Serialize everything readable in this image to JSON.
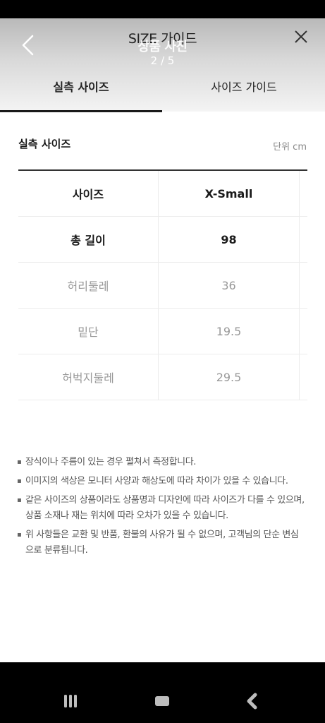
{
  "header": {
    "title": "SIZE 가이드",
    "overlay_title": "상품 사진",
    "counter": "2 / 5"
  },
  "tabs": [
    {
      "label": "실측 사이즈",
      "active": true
    },
    {
      "label": "사이즈 가이드",
      "active": false
    }
  ],
  "section": {
    "title": "실측 사이즈",
    "unit": "단위 cm"
  },
  "table": {
    "rows": [
      {
        "label": "사이즈",
        "value": "X-Small"
      },
      {
        "label": "총 길이",
        "value": "98"
      },
      {
        "label": "허리둘레",
        "value": "36"
      },
      {
        "label": "밑단",
        "value": "19.5"
      },
      {
        "label": "허벅지둘레",
        "value": "29.5"
      }
    ]
  },
  "notes": [
    "장식이나 주름이 있는 경우 펼쳐서 측정합니다.",
    "이미지의 색상은 모니터 사양과 해상도에 따라 차이가 있을 수 있습니다.",
    "같은 사이즈의 상품이라도 상품명과 디자인에 따라 사이즈가 다를 수 있으며, 상품 소재나 재는 위치에 따라 오차가 있을 수 있습니다.",
    "위 사항들은 교환 및 반품, 환불의 사유가 될 수 없으며, 고객님의 단순 변심으로 분류됩니다."
  ],
  "colors": {
    "text_dark": "#1a1a1a",
    "text_muted": "#999999",
    "tab_indicator": "#1a1a1a"
  },
  "icons": {
    "back": "chevron-left-icon",
    "close": "close-icon",
    "nav_recent": "recent-apps-icon",
    "nav_home": "home-icon",
    "nav_back": "back-icon"
  }
}
